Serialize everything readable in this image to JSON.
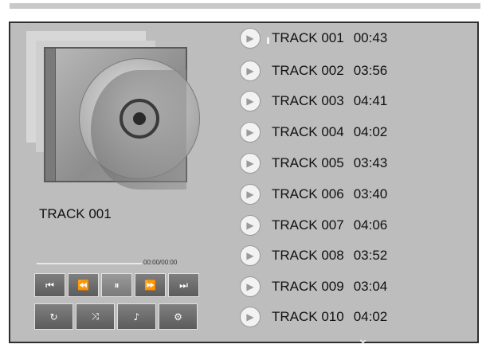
{
  "now_playing": {
    "title": "TRACK 001"
  },
  "player": {
    "time": "00:00/00:00",
    "buttons_row1": [
      {
        "name": "previous-track-button",
        "icon": "⏮"
      },
      {
        "name": "rewind-button",
        "icon": "⏪"
      },
      {
        "name": "pause-button",
        "icon": "⏸"
      },
      {
        "name": "fast-forward-button",
        "icon": "⏩"
      },
      {
        "name": "next-track-button",
        "icon": "⏭"
      }
    ],
    "buttons_row2": [
      {
        "name": "repeat-button",
        "icon": "↻"
      },
      {
        "name": "shuffle-button",
        "icon": "⤨"
      },
      {
        "name": "audio-mute-button",
        "icon": "♪"
      },
      {
        "name": "settings-button",
        "icon": "⚙"
      }
    ]
  },
  "tracks": [
    {
      "title": "TRACK 001",
      "duration": "00:43"
    },
    {
      "title": "TRACK 002",
      "duration": "03:56"
    },
    {
      "title": "TRACK 003",
      "duration": "04:41"
    },
    {
      "title": "TRACK 004",
      "duration": "04:02"
    },
    {
      "title": "TRACK 005",
      "duration": "03:43"
    },
    {
      "title": "TRACK 006",
      "duration": "03:40"
    },
    {
      "title": "TRACK 007",
      "duration": "04:06"
    },
    {
      "title": "TRACK 008",
      "duration": "03:52"
    },
    {
      "title": "TRACK 009",
      "duration": "03:04"
    },
    {
      "title": "TRACK 010",
      "duration": "04:02"
    }
  ],
  "icons": {
    "track_play": "play-icon",
    "scroll_down": "chevron-down-icon"
  }
}
